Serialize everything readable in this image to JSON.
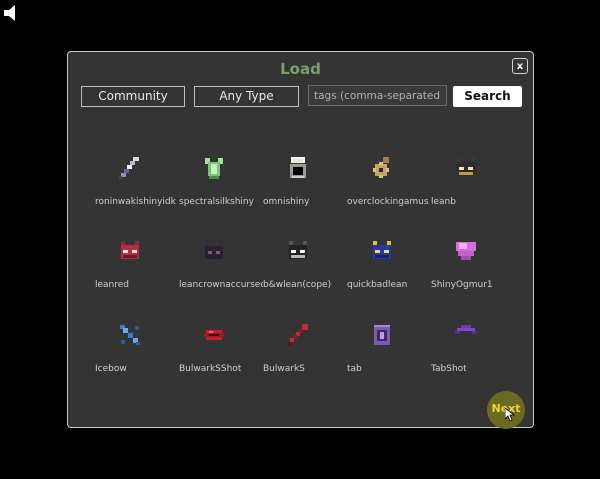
{
  "dialog": {
    "title": "Load",
    "close_label": "x",
    "filters": {
      "source_value": "Community",
      "type_value": "Any Type",
      "tags_placeholder": "tags (comma-separated)",
      "search_label": "Search"
    },
    "items": [
      {
        "name": "roninwakishinyidk",
        "icon": "dagger-icon"
      },
      {
        "name": "spectralsilkshiny",
        "icon": "green-armor-icon"
      },
      {
        "name": "omnishiny",
        "icon": "shiny-ring-icon"
      },
      {
        "name": "overclockingamus",
        "icon": "gear-amulet-icon"
      },
      {
        "name": "leanb",
        "icon": "cat-helm-icon"
      },
      {
        "name": "leanred",
        "icon": "red-helm-icon"
      },
      {
        "name": "leancrownaccursed",
        "icon": "dark-crown-icon"
      },
      {
        "name": "b&wlean(cope)",
        "icon": "bw-helm-icon"
      },
      {
        "name": "quickbadlean",
        "icon": "blue-helm-icon"
      },
      {
        "name": "ShinyOgmur1",
        "icon": "pink-shield-icon"
      },
      {
        "name": "Icebow",
        "icon": "ice-bow-icon"
      },
      {
        "name": "BulwarkSShot",
        "icon": "red-lips-icon"
      },
      {
        "name": "BulwarkS",
        "icon": "red-staff-icon"
      },
      {
        "name": "tab",
        "icon": "purple-tab-icon"
      },
      {
        "name": "TabShot",
        "icon": "purple-cap-icon"
      }
    ],
    "next_label": "Next"
  },
  "colors": {
    "title": "#7f9f6a",
    "next_button": "#6b6a25",
    "next_text": "#f1d23a",
    "panel_bg": "#343434"
  }
}
